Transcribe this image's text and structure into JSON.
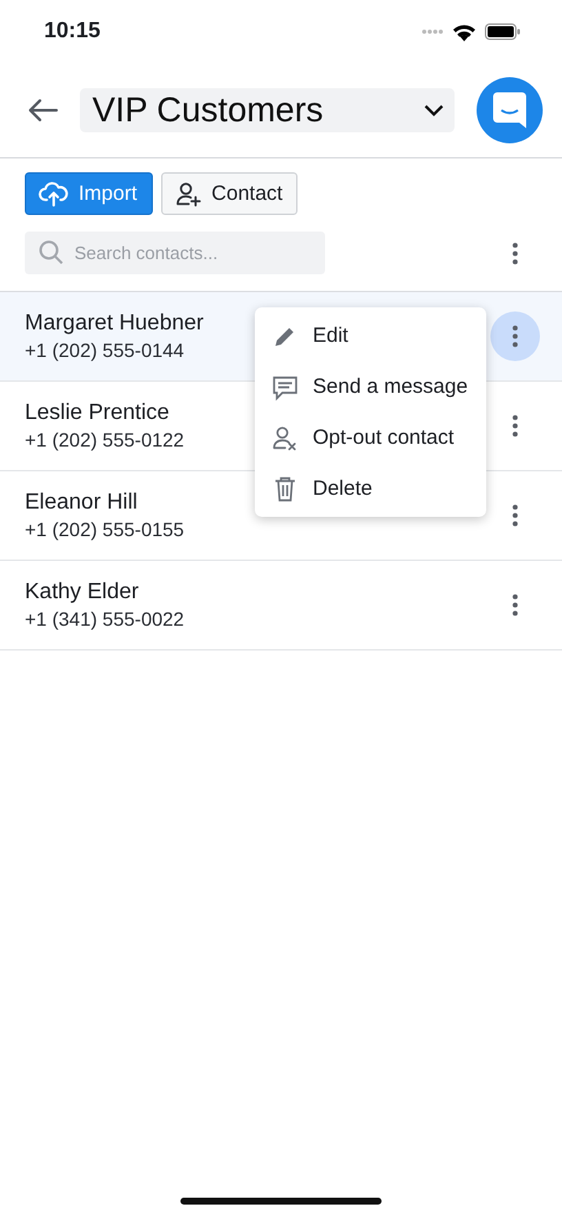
{
  "status_bar": {
    "time": "10:15"
  },
  "header": {
    "title": "VIP Customers"
  },
  "toolbar": {
    "buttons": [
      {
        "label": "Import",
        "kind": "import"
      },
      {
        "label": "Contact",
        "kind": "contact"
      }
    ],
    "search": {
      "placeholder": "Search contacts..."
    }
  },
  "contacts": [
    {
      "name": "Margaret Huebner",
      "phone": "+1 (202) 555-0144",
      "selected": true
    },
    {
      "name": "Leslie Prentice",
      "phone": "+1 (202) 555-0122",
      "selected": false
    },
    {
      "name": "Eleanor Hill",
      "phone": "+1 (202) 555-0155",
      "selected": false
    },
    {
      "name": "Kathy Elder",
      "phone": "+1 (341) 555-0022",
      "selected": false
    }
  ],
  "context_menu": {
    "items": [
      {
        "label": "Edit",
        "kind": "edit"
      },
      {
        "label": "Send a message",
        "kind": "message"
      },
      {
        "label": "Opt-out contact",
        "kind": "optout"
      },
      {
        "label": "Delete",
        "kind": "delete"
      }
    ]
  }
}
